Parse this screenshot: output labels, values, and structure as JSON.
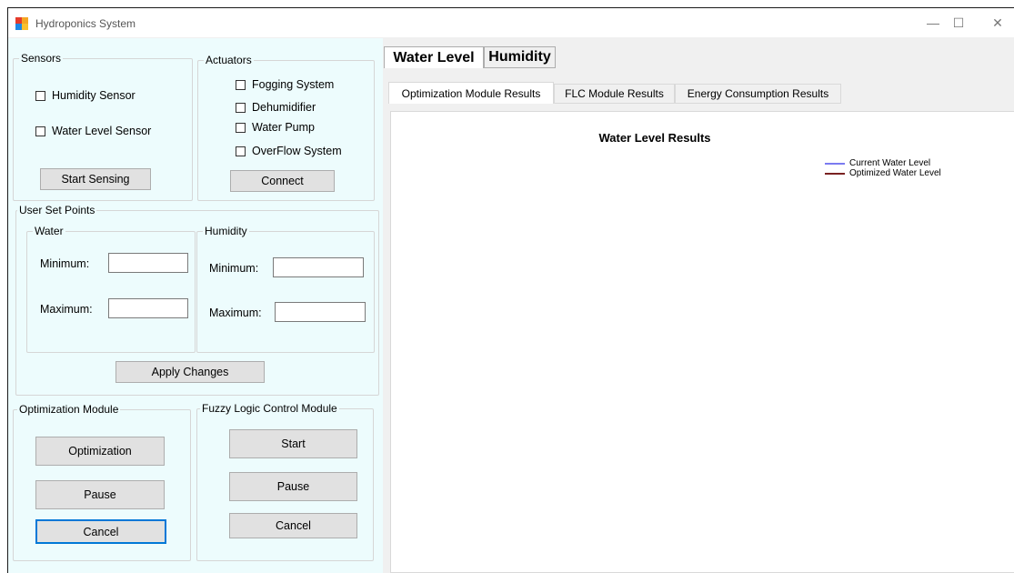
{
  "window": {
    "title": "Hydroponics System",
    "controls": {
      "minimize": "—",
      "maximize": "☐",
      "close": "✕"
    }
  },
  "sensors": {
    "label": "Sensors",
    "items": [
      "Humidity Sensor",
      "Water Level Sensor"
    ],
    "button": "Start Sensing"
  },
  "actuators": {
    "label": "Actuators",
    "items": [
      "Fogging System",
      "Dehumidifier",
      "Water Pump",
      "OverFlow System"
    ],
    "button": "Connect"
  },
  "setpoints": {
    "label": "User Set Points",
    "water": {
      "label": "Water",
      "min_label": "Minimum:",
      "max_label": "Maximum:",
      "min_value": "",
      "max_value": ""
    },
    "humidity": {
      "label": "Humidity",
      "min_label": "Minimum:",
      "max_label": "Maximum:",
      "min_value": "",
      "max_value": ""
    },
    "apply_button": "Apply Changes"
  },
  "optimization": {
    "label": "Optimization Module",
    "buttons": [
      "Optimization",
      "Pause",
      "Cancel"
    ]
  },
  "fuzzy": {
    "label": "Fuzzy Logic Control Module",
    "buttons": [
      "Start",
      "Pause",
      "Cancel"
    ]
  },
  "main_tabs": [
    "Water Level",
    "Humidity"
  ],
  "sub_tabs": [
    "Optimization Module Results",
    "FLC Module Results",
    "Energy Consumption Results"
  ],
  "chart": {
    "title": "Water Level Results",
    "legend": [
      {
        "name": "Current Water Level",
        "color": "#7b7bf0"
      },
      {
        "name": "Optimized Water Level",
        "color": "#7a2222"
      }
    ]
  },
  "colors": {
    "left_panel_bg": "#edfcfd",
    "focus_border": "#0078d7"
  }
}
